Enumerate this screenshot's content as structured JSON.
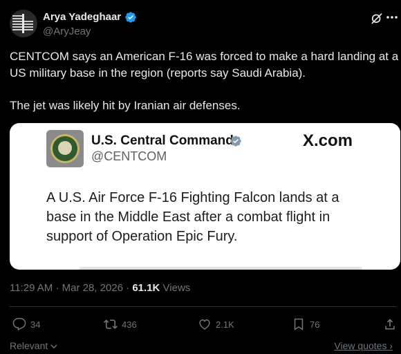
{
  "author": {
    "name": "Arya Yadeghaar",
    "handle": "@AryJeay"
  },
  "tweet": {
    "lines": [
      "CENTCOM says an American F-16 was forced to make a hard landing at a",
      "US military base in the region (reports say Saudi Arabia).",
      "The jet was likely hit by Iranian air defenses."
    ]
  },
  "card": {
    "name": "U.S. Central Command",
    "handle": "@CENTCOM",
    "source": "X.com",
    "body_lines": [
      "A U.S. Air Force F-16 Fighting Falcon lands at a",
      "base in the Middle East after a combat flight in",
      "support of Operation Epic Fury."
    ]
  },
  "meta": {
    "time": "11:29 AM",
    "date": "Mar 28, 2026",
    "views_count": "61.1K",
    "views_label": "Views"
  },
  "actions": {
    "replies": "34",
    "reposts": "436",
    "likes": "2.1K",
    "bookmarks": "76"
  },
  "footer": {
    "relevant": "Relevant",
    "view_quotes": "View quotes"
  },
  "colors": {
    "background": "#000000",
    "verified": "#1d9bf0",
    "muted": "#71767b"
  }
}
